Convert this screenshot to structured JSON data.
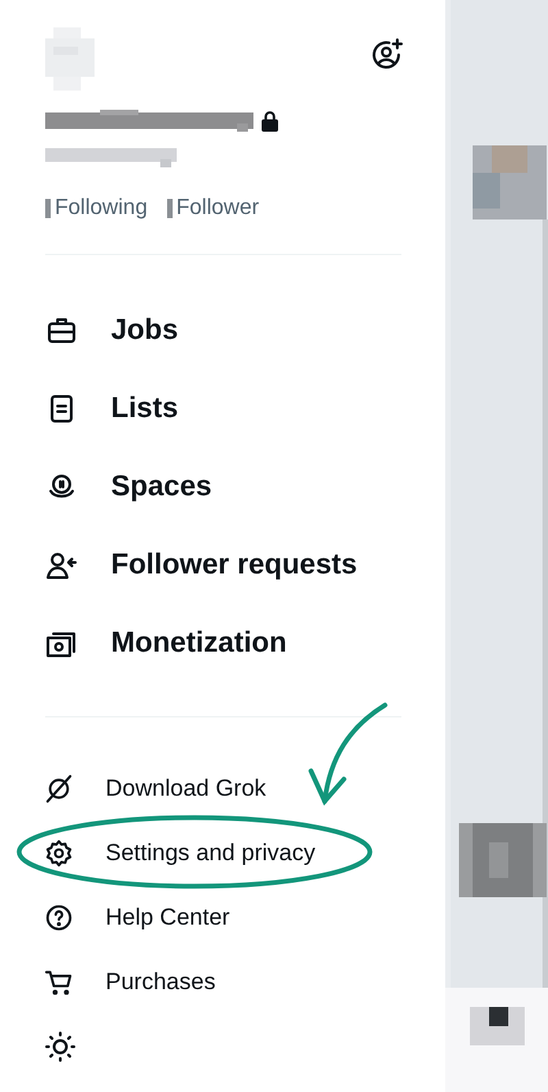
{
  "header": {
    "locked": true,
    "stats": [
      {
        "label": "Following"
      },
      {
        "label": "Follower"
      }
    ]
  },
  "menu_items": [
    {
      "label": "Jobs"
    },
    {
      "label": "Lists"
    },
    {
      "label": "Spaces"
    },
    {
      "label": "Follower requests"
    },
    {
      "label": "Monetization"
    }
  ],
  "secondary_items": [
    {
      "label": "Download Grok",
      "highlighted": false
    },
    {
      "label": "Settings and privacy",
      "highlighted": true
    },
    {
      "label": "Help Center",
      "highlighted": false
    },
    {
      "label": "Purchases",
      "highlighted": false
    }
  ]
}
